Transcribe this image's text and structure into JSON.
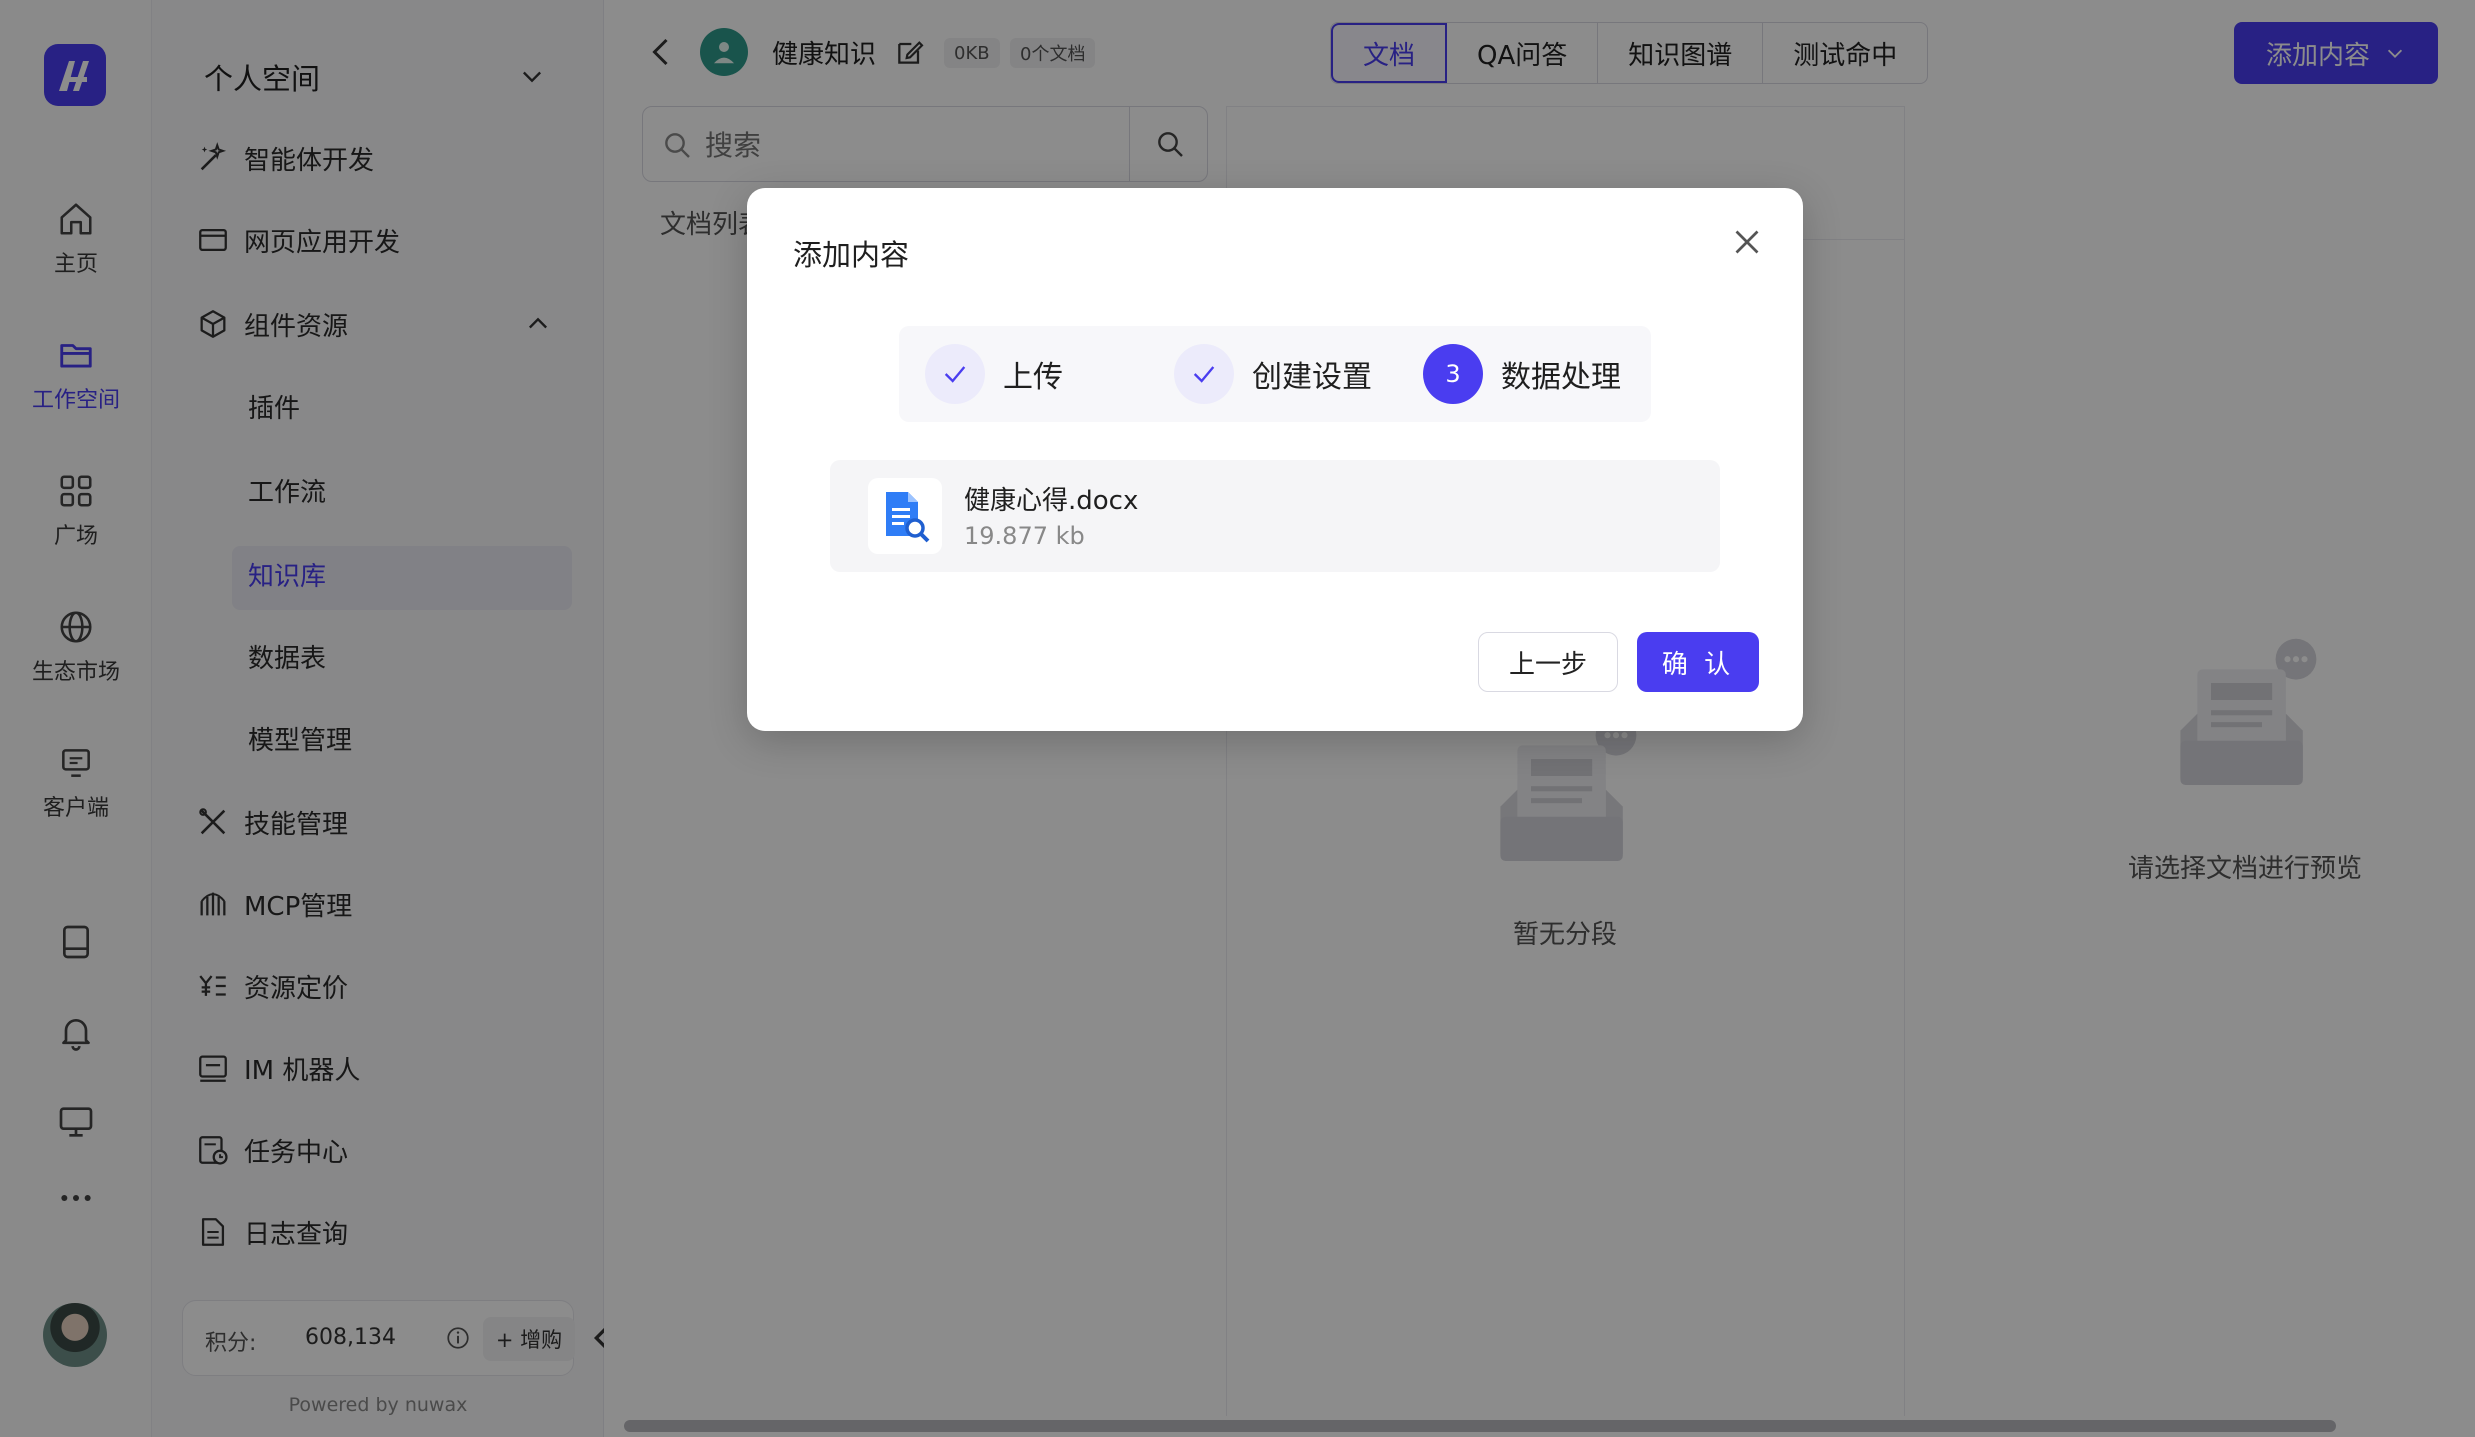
{
  "rail": {
    "items": [
      {
        "label": "主页"
      },
      {
        "label": "工作空间"
      },
      {
        "label": "广场"
      },
      {
        "label": "生态市场"
      },
      {
        "label": "客户端"
      }
    ],
    "icons": [
      "book-icon",
      "bell-icon",
      "monitor-icon",
      "more-icon"
    ],
    "accent": "#4a3df0"
  },
  "sidebar": {
    "title": "个人空间",
    "items": [
      {
        "label": "智能体开发"
      },
      {
        "label": "网页应用开发"
      },
      {
        "label": "组件资源"
      }
    ],
    "sub_items": [
      {
        "label": "插件"
      },
      {
        "label": "工作流"
      },
      {
        "label": "知识库"
      },
      {
        "label": "数据表"
      },
      {
        "label": "模型管理"
      }
    ],
    "bottom_items": [
      {
        "label": "技能管理"
      },
      {
        "label": "MCP管理"
      },
      {
        "label": "资源定价"
      },
      {
        "label": "IM 机器人"
      },
      {
        "label": "任务中心"
      },
      {
        "label": "日志查询"
      }
    ],
    "points_label": "积分:",
    "points_value": "608,134",
    "buy_label": "+ 增购",
    "powered_by": "Powered by nuwax"
  },
  "header": {
    "kb_name": "健康知识",
    "size_badge": "0KB",
    "doc_count_badge": "0个文档",
    "tabs": [
      {
        "label": "文档"
      },
      {
        "label": "QA问答"
      },
      {
        "label": "知识图谱"
      },
      {
        "label": "测试命中"
      }
    ],
    "add_button": "添加内容"
  },
  "main": {
    "search_placeholder": "搜索",
    "doc_list_label": "文档列表",
    "empty_segments": "暂无分段",
    "empty_preview": "请选择文档进行预览"
  },
  "modal": {
    "title": "添加内容",
    "steps": [
      {
        "label": "上传",
        "state": "done"
      },
      {
        "label": "创建设置",
        "state": "done"
      },
      {
        "label": "数据处理",
        "number": "3",
        "state": "current"
      }
    ],
    "file": {
      "name": "健康心得.docx",
      "size": "19.877 kb"
    },
    "prev_button": "上一步",
    "confirm_button": "确 认"
  }
}
